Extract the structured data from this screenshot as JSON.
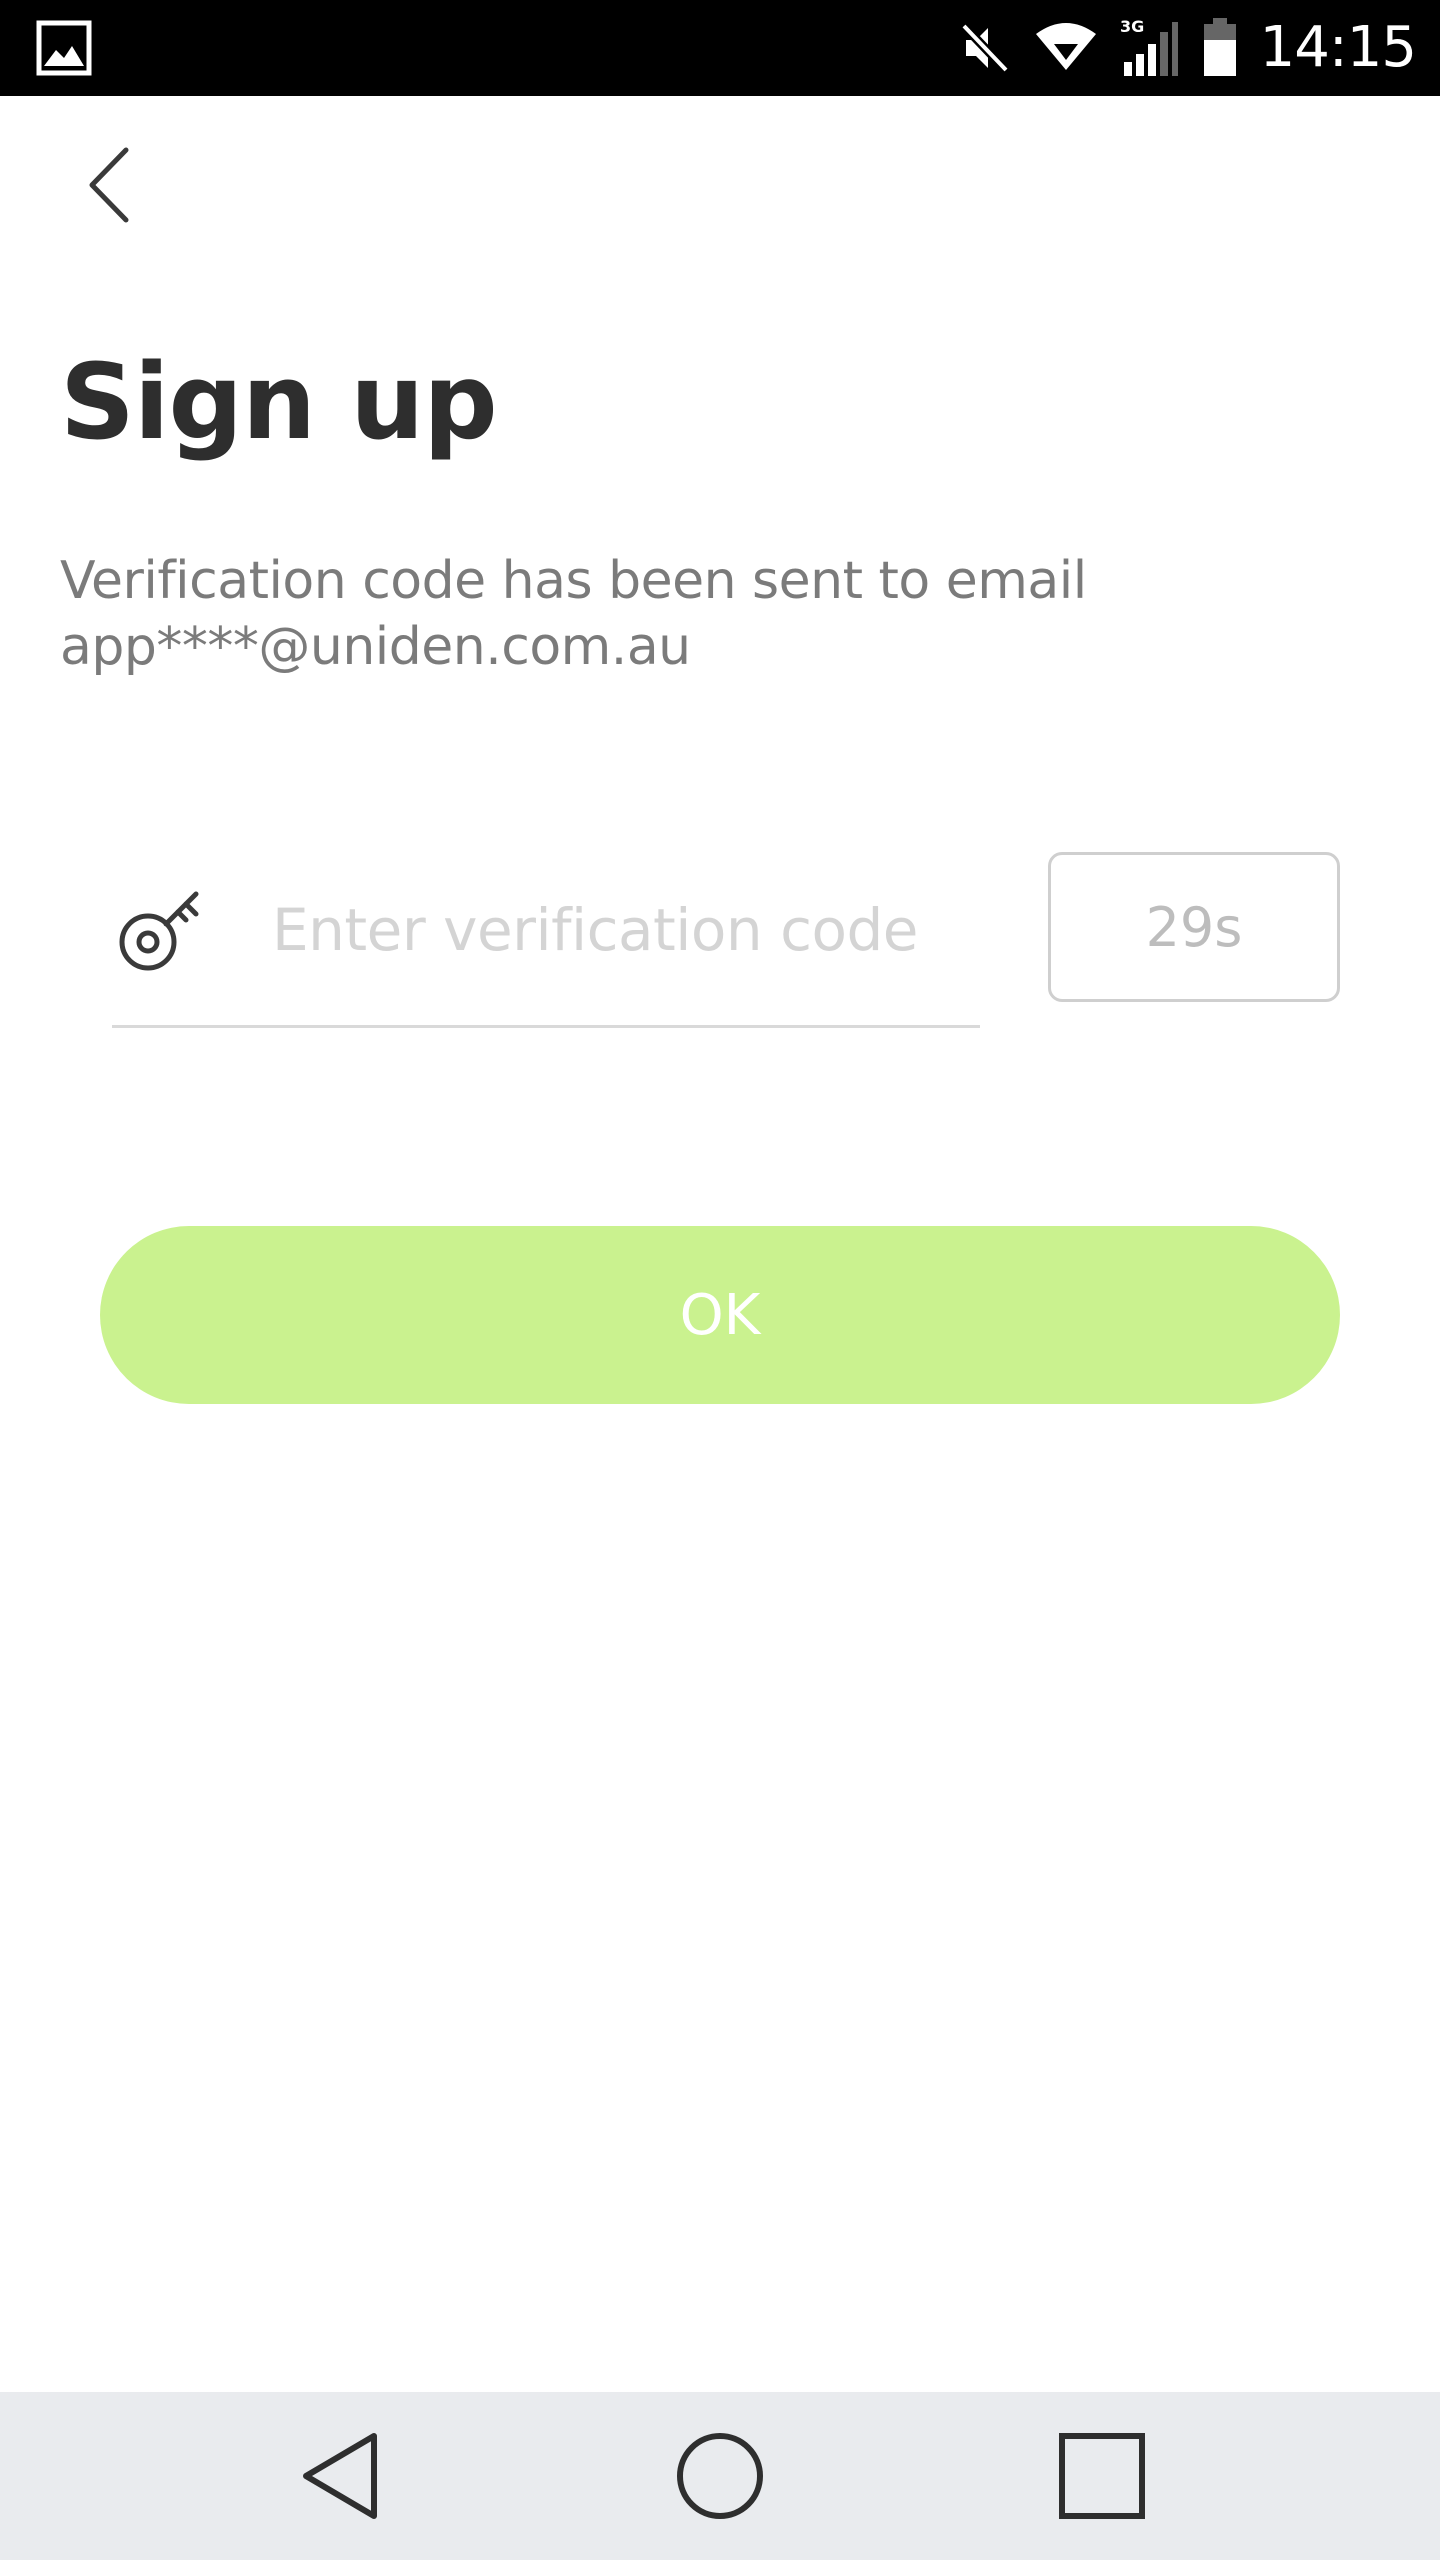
{
  "status_bar": {
    "time": "14:15",
    "network_label": "3G",
    "icons": [
      "image-notification-icon",
      "mute-icon",
      "wifi-icon",
      "signal-icon",
      "battery-icon"
    ]
  },
  "header": {
    "back_icon": "chevron-left-icon"
  },
  "page": {
    "title": "Sign up",
    "message_line1": "Verification code has been sent to email",
    "message_line2": "app****@uniden.com.au"
  },
  "form": {
    "key_icon": "key-icon",
    "code_value": "",
    "code_placeholder": "Enter verification code",
    "countdown_label": "29s"
  },
  "actions": {
    "ok_label": "OK",
    "ok_color": "#caf28f"
  },
  "nav_bar": {
    "icons": [
      "nav-back-icon",
      "nav-home-icon",
      "nav-recent-icon"
    ]
  },
  "colors": {
    "status_bar_bg": "#000000",
    "title_text": "#2e2e2e",
    "message_text": "#7b7b7b",
    "placeholder_text": "#d4d4d4",
    "nav_bar_bg": "#e9ebee"
  }
}
